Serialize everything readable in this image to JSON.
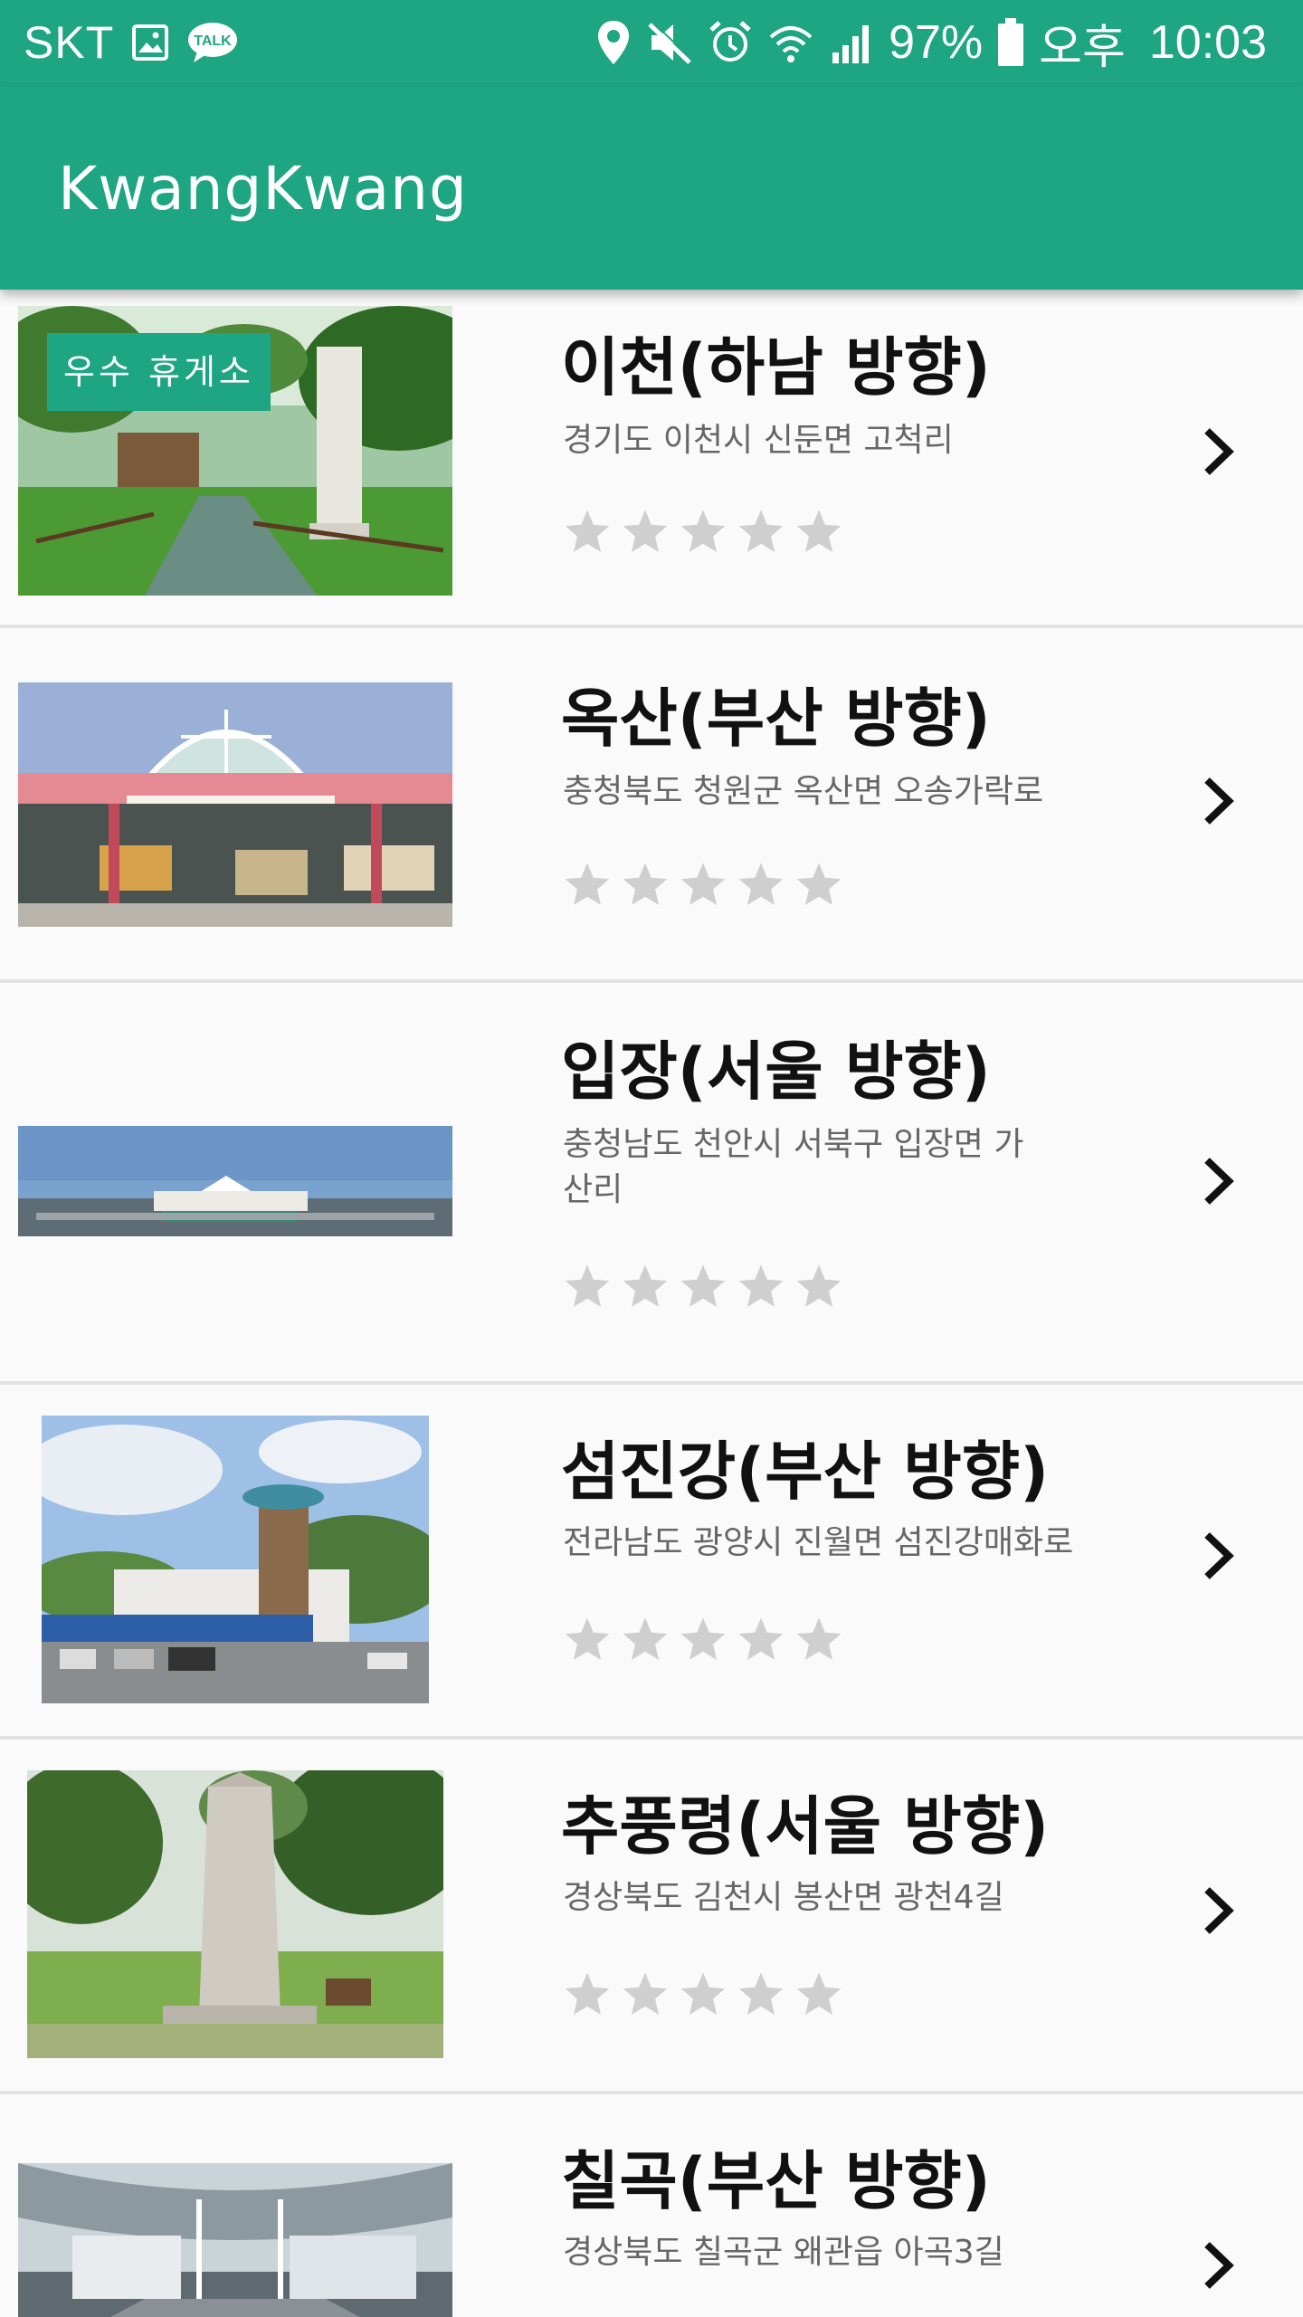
{
  "status_bar": {
    "carrier": "SKT",
    "battery": "97%",
    "ampm": "오후",
    "time": "10:03",
    "left_icons": [
      "image-icon",
      "talk-icon"
    ],
    "right_icons": [
      "location-icon",
      "mute-icon",
      "alarm-icon",
      "wifi-icon",
      "signal-icon",
      "battery-icon"
    ]
  },
  "app_bar": {
    "title": "KwangKwang"
  },
  "colors": {
    "primary": "#1ea582",
    "star_inactive": "#cfcfcf",
    "divider": "#e2e2e2"
  },
  "list": [
    {
      "name": "이천(하남 방향)",
      "address": "경기도 이천시 신둔면 고척리",
      "badge": "우수 휴게소",
      "rating": 0,
      "image": "park-monument-photo"
    },
    {
      "name": "옥산(부산 방향)",
      "address": "충청북도 청원군 옥산면 오송가락로",
      "rating": 0,
      "image": "rest-area-entrance-photo"
    },
    {
      "name": "입장(서울 방향)",
      "address": "충청남도 천안시 서북구 입장면 가산리",
      "rating": 0,
      "image": "rest-area-panorama-photo"
    },
    {
      "name": "섬진강(부산 방향)",
      "address": "전라남도 광양시 진월면 섬진강매화로",
      "rating": 0,
      "image": "rest-area-building-photo"
    },
    {
      "name": "추풍령(서울 방향)",
      "address": "경상북도 김천시 봉산면 광천4길",
      "rating": 0,
      "image": "monument-stone-photo"
    },
    {
      "name": "칠곡(부산 방향)",
      "address": "경상북도 칠곡군 왜관읍 아곡3길",
      "rating": 0,
      "image": "plaza-panorama-photo"
    }
  ]
}
